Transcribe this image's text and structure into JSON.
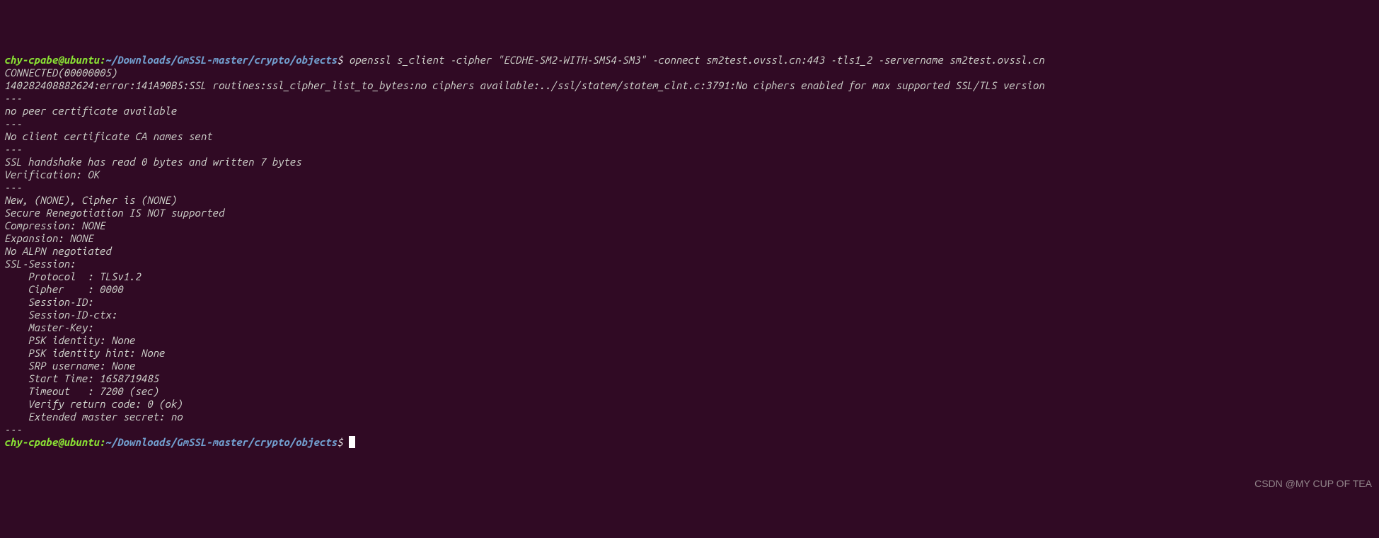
{
  "prompt": {
    "user_host": "chy-cpabe@ubuntu",
    "separator": ":",
    "path": "~/Downloads/GmSSL-master/crypto/objects",
    "dollar": "$"
  },
  "command": " openssl s_client -cipher \"ECDHE-SM2-WITH-SMS4-SM3\" -connect sm2test.ovssl.cn:443 -tls1_2 -servername sm2test.ovssl.cn",
  "lines": [
    "CONNECTED(00000005)",
    "140282408882624:error:141A90B5:SSL routines:ssl_cipher_list_to_bytes:no ciphers available:../ssl/statem/statem_clnt.c:3791:No ciphers enabled for max supported SSL/TLS version",
    "---",
    "no peer certificate available",
    "---",
    "No client certificate CA names sent",
    "---",
    "SSL handshake has read 0 bytes and written 7 bytes",
    "Verification: OK",
    "---",
    "New, (NONE), Cipher is (NONE)",
    "Secure Renegotiation IS NOT supported",
    "Compression: NONE",
    "Expansion: NONE",
    "No ALPN negotiated",
    "SSL-Session:",
    "    Protocol  : TLSv1.2",
    "    Cipher    : 0000",
    "    Session-ID:",
    "    Session-ID-ctx:",
    "    Master-Key:",
    "    PSK identity: None",
    "    PSK identity hint: None",
    "    SRP username: None",
    "    Start Time: 1658719485",
    "    Timeout   : 7200 (sec)",
    "    Verify return code: 0 (ok)",
    "    Extended master secret: no",
    "---"
  ],
  "watermark": "CSDN @MY CUP OF TEA"
}
